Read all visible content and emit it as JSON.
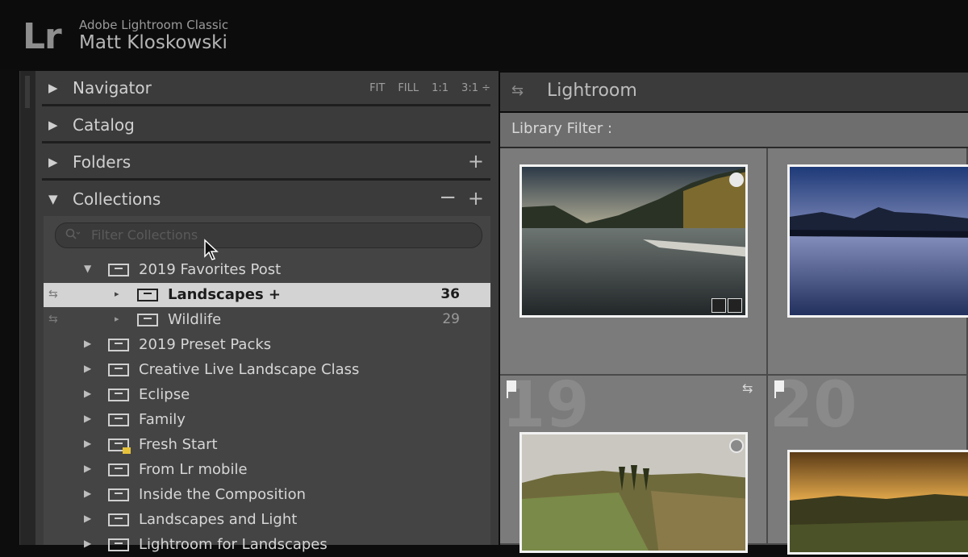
{
  "titlebar": {
    "logo": "Lr",
    "app_name": "Adobe Lightroom Classic",
    "user_name": "Matt Kloskowski"
  },
  "left_panel": {
    "navigator": {
      "title": "Navigator",
      "controls": [
        "FIT",
        "FILL",
        "1:1",
        "3:1 ÷"
      ]
    },
    "catalog": {
      "title": "Catalog"
    },
    "folders": {
      "title": "Folders",
      "add": "+"
    },
    "collections": {
      "title": "Collections",
      "remove": "−",
      "add": "+",
      "filter_placeholder": "Filter Collections",
      "items": [
        {
          "name": "2019 Favorites Post",
          "expanded": true
        },
        {
          "name": "Landscapes +",
          "count": "36",
          "selected": true
        },
        {
          "name": "Wildlife",
          "count": "29"
        },
        {
          "name": "2019 Preset Packs"
        },
        {
          "name": "Creative Live Landscape Class"
        },
        {
          "name": "Eclipse"
        },
        {
          "name": "Family"
        },
        {
          "name": "Fresh Start"
        },
        {
          "name": "From Lr mobile"
        },
        {
          "name": "Inside the Composition"
        },
        {
          "name": "Landscapes and Light"
        },
        {
          "name": "Lightroom for Landscapes"
        }
      ]
    }
  },
  "right_panel": {
    "header_title": "Lightroom",
    "filter_label": "Library Filter :",
    "cells": [
      {
        "number": ""
      },
      {
        "number": ""
      },
      {
        "number": "19"
      },
      {
        "number": "20"
      }
    ]
  },
  "icons": {
    "disclosure_closed": "triangle-right-icon",
    "disclosure_open": "triangle-down-icon",
    "collection_set": "collection-set-icon",
    "sync": "sync-arrows-icon",
    "search": "search-icon",
    "flag": "flag-icon"
  }
}
